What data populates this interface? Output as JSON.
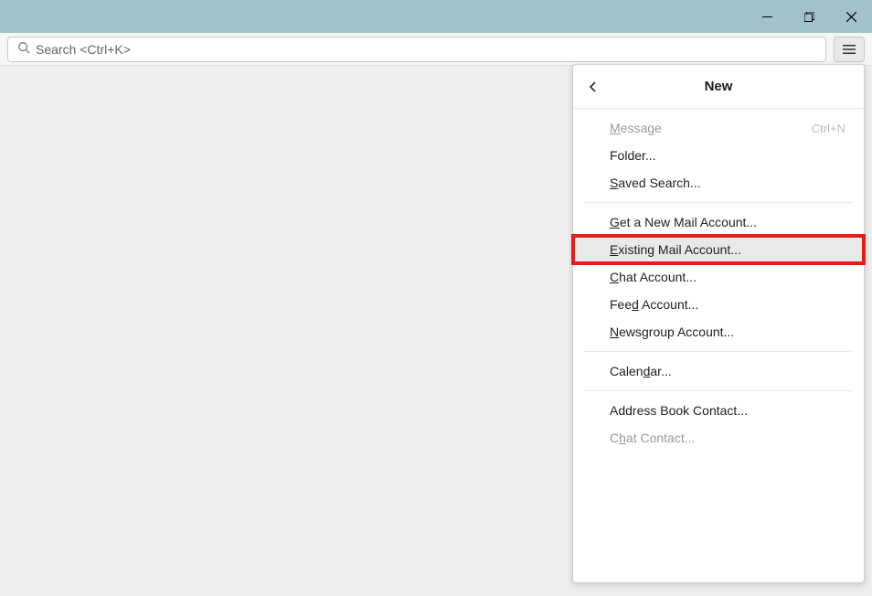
{
  "search": {
    "placeholder": "Search <Ctrl+K>"
  },
  "menu": {
    "title": "New",
    "items": [
      {
        "label": "Message",
        "underline_index": 0,
        "shortcut": "Ctrl+N",
        "disabled": true
      },
      {
        "label": "Folder...",
        "underline_index": -1
      },
      {
        "label": "Saved Search...",
        "underline_index": 0
      },
      "---",
      {
        "label": "Get a New Mail Account...",
        "underline_index": 0
      },
      {
        "label": "Existing Mail Account...",
        "underline_index": 0,
        "highlighted": true
      },
      {
        "label": "Chat Account...",
        "underline_index": 0
      },
      {
        "label": "Feed Account...",
        "underline_index": 3
      },
      {
        "label": "Newsgroup Account...",
        "underline_index": 0
      },
      "---",
      {
        "label": "Calendar...",
        "underline_index": 5
      },
      "---",
      {
        "label": "Address Book Contact...",
        "underline_index": -1
      },
      {
        "label": "Chat Contact...",
        "underline_index": 1,
        "disabled": true
      }
    ]
  }
}
